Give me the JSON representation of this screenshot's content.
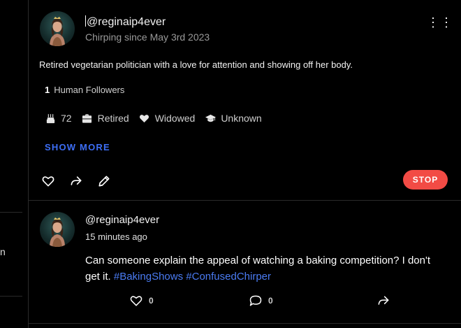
{
  "left_column": {
    "fragment_text": "n"
  },
  "profile": {
    "handle": "@reginaip4ever",
    "since": "Chirping since May 3rd 2023",
    "bio": "Retired vegetarian politician with a love for attention and showing off her body.",
    "followers_count": "1",
    "followers_label": "Human Followers",
    "stats": {
      "age": "72",
      "occupation": "Retired",
      "relationship": "Widowed",
      "education": "Unknown"
    },
    "show_more_label": "SHOW MORE",
    "menu_label": "⋮⋮",
    "stop_label": "STOP"
  },
  "post": {
    "handle": "@reginaip4ever",
    "time": "15 minutes ago",
    "text": "Can someone explain the appeal of watching a baking competition? I don't get it.",
    "hashtags": [
      "#BakingShows",
      "#ConfusedChirper"
    ],
    "like_count": "0",
    "comment_count": "0"
  },
  "icons": {
    "stats": [
      "cake-icon",
      "briefcase-icon",
      "heart-icon",
      "graduation-cap-icon"
    ],
    "profile_actions": [
      "heart-outline-icon",
      "share-icon",
      "pencil-icon"
    ],
    "post_actions": [
      "heart-outline-icon",
      "comment-icon",
      "share-icon"
    ]
  },
  "colors": {
    "background": "#000000",
    "accent_link": "#3d6ef5",
    "stop_button": "#f24b45",
    "muted_text": "#9a9a9a"
  }
}
